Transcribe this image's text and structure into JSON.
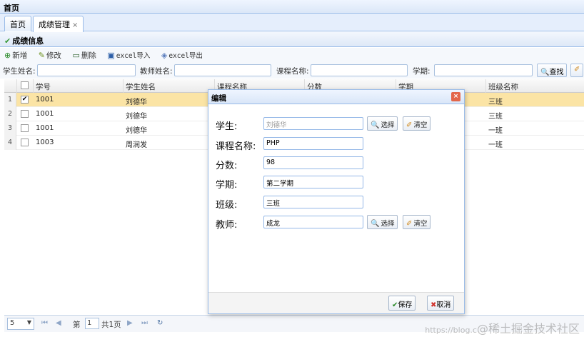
{
  "topbar": {
    "title": "首页"
  },
  "tabs": [
    {
      "label": "首页"
    },
    {
      "label": "成绩管理",
      "close": "×"
    }
  ],
  "panel": {
    "title": "成绩信息"
  },
  "toolbar": {
    "add": "新增",
    "edit": "修改",
    "delete": "删除",
    "import": "excel导入",
    "export": "excel导出"
  },
  "search": {
    "student_label": "学生姓名:",
    "teacher_label": "教师姓名:",
    "course_label": "课程名称:",
    "term_label": "学期:",
    "search_button": "查找"
  },
  "grid": {
    "columns": [
      "学号",
      "学生姓名",
      "课程名称",
      "分数",
      "学期",
      "班级名称"
    ],
    "rows": [
      {
        "num": "1",
        "checked": "✔",
        "id": "1001",
        "name": "刘德华",
        "class": "三班"
      },
      {
        "num": "2",
        "checked": "",
        "id": "1001",
        "name": "刘德华",
        "class": "三班"
      },
      {
        "num": "3",
        "checked": "",
        "id": "1001",
        "name": "刘德华",
        "class": "一班"
      },
      {
        "num": "4",
        "checked": "",
        "id": "1003",
        "name": "周润发",
        "class": "一班"
      }
    ]
  },
  "pager": {
    "page_size": "5",
    "page_prefix": "第",
    "page_value": "1",
    "page_total": "共1页"
  },
  "dialog": {
    "title": "编辑",
    "close": "×",
    "fields": {
      "student_label": "学生:",
      "student_value": "刘德华",
      "course_label": "课程名称:",
      "course_value": "PHP",
      "score_label": "分数:",
      "score_value": "98",
      "term_label": "学期:",
      "term_value": "第二学期",
      "class_label": "班级:",
      "class_value": "三班",
      "teacher_label": "教师:",
      "teacher_value": "成龙"
    },
    "choose": "选择",
    "clear": "清空",
    "save": "保存",
    "cancel": "取消"
  },
  "watermark": {
    "prefix": "https://blog.c",
    "text": "@稀土掘金技术社区"
  }
}
